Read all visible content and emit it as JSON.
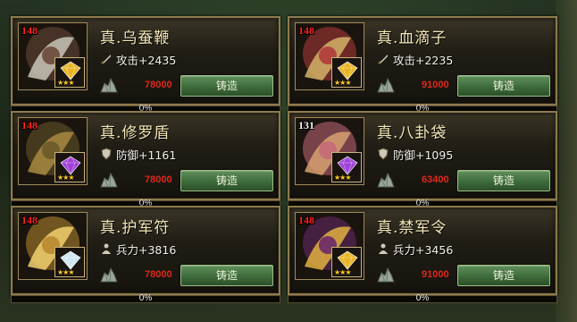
{
  "forge_button_label": "铸造",
  "cards": [
    {
      "level": "148",
      "level_color": "#ff2020",
      "name": "真.乌蚕鞭",
      "stat": "攻击+2435",
      "stat_icon": "sword-icon",
      "cost": "78000",
      "progress": "0%",
      "gem": "gold-gem",
      "gem_color": "#e8b422"
    },
    {
      "level": "148",
      "level_color": "#ff2020",
      "name": "真.血滴子",
      "stat": "攻击+2235",
      "stat_icon": "sword-icon",
      "cost": "91000",
      "progress": "0%",
      "gem": "gold-gem",
      "gem_color": "#e8b422"
    },
    {
      "level": "148",
      "level_color": "#ff2020",
      "name": "真.修罗盾",
      "stat": "防御+1161",
      "stat_icon": "shield-icon",
      "cost": "78000",
      "progress": "0%",
      "gem": "purple-gem",
      "gem_color": "#a040d8"
    },
    {
      "level": "131",
      "level_color": "#f4f4f4",
      "name": "真.八卦袋",
      "stat": "防御+1095",
      "stat_icon": "shield-icon",
      "cost": "63400",
      "progress": "0%",
      "gem": "purple-gem",
      "gem_color": "#a040d8"
    },
    {
      "level": "148",
      "level_color": "#ff2020",
      "name": "真.护军符",
      "stat": "兵力+3816",
      "stat_icon": "soldier-icon",
      "cost": "78000",
      "progress": "0%",
      "gem": "white-gem",
      "gem_color": "#cfe6f2"
    },
    {
      "level": "148",
      "level_color": "#ff2020",
      "name": "真.禁军令",
      "stat": "兵力+3456",
      "stat_icon": "soldier-icon",
      "cost": "91000",
      "progress": "0%",
      "gem": "gold-gem",
      "gem_color": "#e8b422"
    }
  ]
}
